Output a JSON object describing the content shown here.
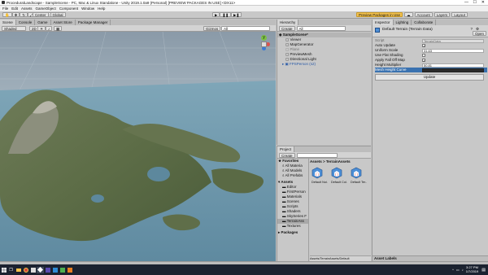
{
  "window": {
    "title": "ProceduralLandscape - SampleScene - PC, Mac & Linux Standalone - Unity 2019.1.0a9 (Personal) [PREVIEW PACKAGES IN USE] <DX11>"
  },
  "menu": [
    "File",
    "Edit",
    "Assets",
    "GameObject",
    "Component",
    "Window",
    "Help"
  ],
  "toolbar": {
    "center": "Center",
    "global": "Global",
    "preview_packages": "Preview Packages in Use",
    "account": "Account",
    "layers": "Layers",
    "layout": "Layout"
  },
  "scene_tabs": [
    "Scene",
    "Console",
    "Game",
    "Asset Store",
    "Package Manager"
  ],
  "scene_toolbar": {
    "shading": "Shaded",
    "mode": "2D",
    "gizmos": "Gizmos",
    "search": "All"
  },
  "gizmo": {
    "y_axis": "y"
  },
  "hierarchy": {
    "tab": "Hierarchy",
    "create": "Create",
    "search": "All",
    "items": [
      {
        "label": "SampleScene*"
      },
      {
        "label": "Viewer"
      },
      {
        "label": "MapGenerator"
      },
      {
        "label": "Plane"
      },
      {
        "label": "PreviewMesh"
      },
      {
        "label": "Directional Light"
      },
      {
        "label": "FPSPerson (s2)"
      }
    ]
  },
  "inspector": {
    "tabs": [
      "Inspector",
      "Lighting",
      "Collaborate"
    ],
    "title": "Default Terrain (Terrain Data)",
    "open": "Open",
    "script_label": "Script",
    "script_value": "TerrainData",
    "props": [
      {
        "label": "Auto Update",
        "type": "check",
        "value": "✓"
      },
      {
        "label": "Uniform Scale",
        "type": "text",
        "value": "31.63"
      },
      {
        "label": "Use Flat Shading",
        "type": "check",
        "value": ""
      },
      {
        "label": "Apply Fall Off Map",
        "type": "check",
        "value": "✓"
      },
      {
        "label": "Height Multiplier",
        "type": "text",
        "value": "50.81"
      },
      {
        "label": "Mesh Height Curve",
        "type": "curve",
        "value": ""
      }
    ],
    "update": "Update",
    "asset_labels": "Asset Labels"
  },
  "project": {
    "tab": "Project",
    "create": "Create",
    "breadcrumb": "Assets > TerrainAssets",
    "favorites_label": "Favorites",
    "favorites": [
      "All Materia",
      "All Models",
      "All Prefabs"
    ],
    "assets_label": "Assets",
    "folders": [
      "Editor",
      "FirstPerson",
      "Materials",
      "Scenes",
      "Scripts",
      "Shaders",
      "SkySeries F",
      "TerrainAss",
      "Textures"
    ],
    "packages_label": "Packages",
    "asset_items": [
      "Default Noi...",
      "Default Col...",
      "Default Ter..."
    ],
    "status_path": "Assets/TerrainAssets/Default"
  },
  "taskbar": {
    "time": "3:27 PM",
    "date": "1/7/2019"
  },
  "colors": {
    "accent": "#3d79d8",
    "selection": "#3a72b0",
    "bar": "#1b2230"
  }
}
